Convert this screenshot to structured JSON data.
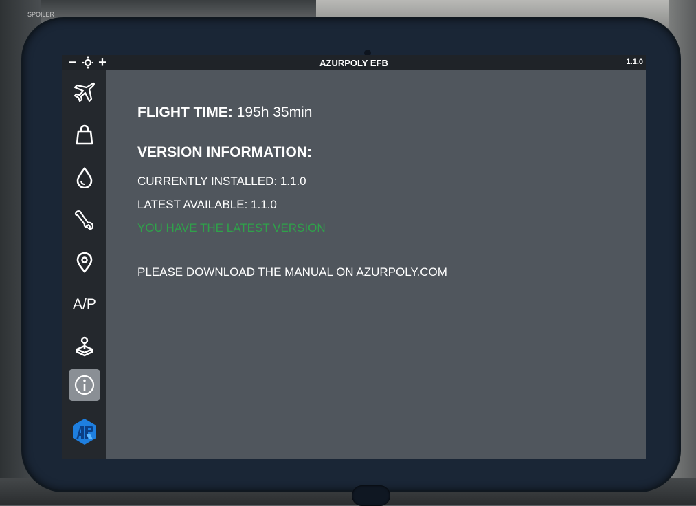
{
  "topbar": {
    "brightness_down": "−",
    "brightness_up": "+",
    "title": "AZURPOLY EFB",
    "version": "1.1.0"
  },
  "sidebar": {
    "items": [
      {
        "id": "flight",
        "icon": "airplane-icon"
      },
      {
        "id": "payload",
        "icon": "bag-icon"
      },
      {
        "id": "fuel",
        "icon": "droplet-icon"
      },
      {
        "id": "tools",
        "icon": "wrench-icon"
      },
      {
        "id": "navigation",
        "icon": "location-pin-icon"
      },
      {
        "id": "autopilot",
        "label": "A/P"
      },
      {
        "id": "controls",
        "icon": "joystick-icon"
      },
      {
        "id": "info",
        "icon": "info-icon",
        "active": true
      },
      {
        "id": "brand",
        "icon": "azurpoly-logo-icon"
      }
    ]
  },
  "content": {
    "flight_time_label": "FLIGHT TIME:",
    "flight_time_value": "195h 35min",
    "version_heading": "VERSION INFORMATION:",
    "currently_installed": "CURRENTLY INSTALLED: 1.1.0",
    "latest_available": "LATEST AVAILABLE: 1.1.0",
    "status": "YOU HAVE THE LATEST VERSION",
    "manual_note": "PLEASE DOWNLOAD THE MANUAL ON AZURPOLY.COM"
  },
  "background": {
    "spoiler_label": "SPOILER"
  },
  "colors": {
    "status_ok": "#2fa24a",
    "bezel": "#1a2636",
    "screen": "#50565d",
    "sidebar": "#24282d",
    "brand_blue": "#1e7fe0"
  }
}
